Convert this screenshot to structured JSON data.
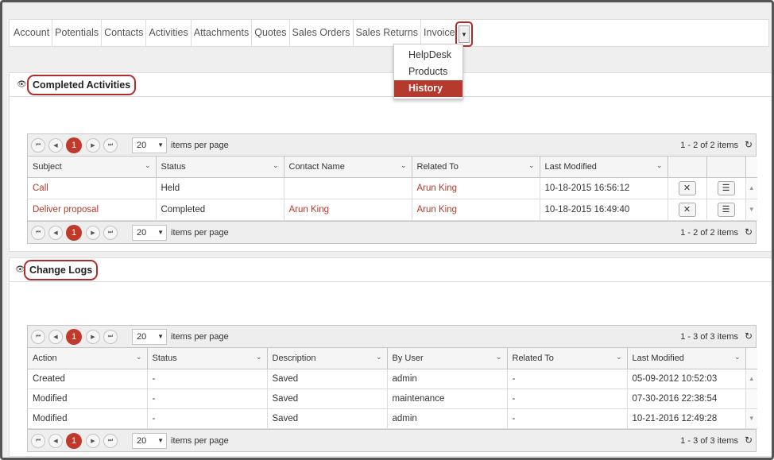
{
  "tabs": [
    "Account",
    "Potentials",
    "Contacts",
    "Activities",
    "Attachments",
    "Quotes",
    "Sales Orders",
    "Sales Returns",
    "Invoices"
  ],
  "more_menu": [
    "HelpDesk",
    "Products",
    "History"
  ],
  "completed": {
    "title": "Completed Activities",
    "page": "1",
    "page_size": "20",
    "items_per_page_label": "items per page",
    "info": "1 - 2 of 2 items",
    "columns": [
      "Subject",
      "Status",
      "Contact Name",
      "Related To",
      "Last Modified"
    ],
    "rows": [
      {
        "subject": "Call",
        "status": "Held",
        "contact": "",
        "related": "Arun King",
        "modified": "10-18-2015 16:56:12"
      },
      {
        "subject": "Deliver proposal",
        "status": "Completed",
        "contact": "Arun King",
        "related": "Arun King",
        "modified": "10-18-2015 16:49:40"
      }
    ]
  },
  "logs": {
    "title": "Change Logs",
    "page": "1",
    "page_size": "20",
    "items_per_page_label": "items per page",
    "info": "1 - 3 of 3 items",
    "columns": [
      "Action",
      "Status",
      "Description",
      "By User",
      "Related To",
      "Last Modified"
    ],
    "rows": [
      {
        "action": "Created",
        "status": "-",
        "description": "Saved",
        "user": "admin",
        "related": "-",
        "modified": "05-09-2012 10:52:03"
      },
      {
        "action": "Modified",
        "status": "-",
        "description": "Saved",
        "user": "maintenance",
        "related": "-",
        "modified": "07-30-2016 22:38:54"
      },
      {
        "action": "Modified",
        "status": "-",
        "description": "Saved",
        "user": "admin",
        "related": "-",
        "modified": "10-21-2016 12:49:28"
      }
    ]
  },
  "icons": {
    "first": "first-page-icon",
    "prev": "prev-page-icon",
    "next": "next-page-icon",
    "last": "last-page-icon",
    "refresh": "refresh-icon",
    "delete": "close-icon",
    "menu": "menu-icon",
    "eye": "eye-icon",
    "chevron": "chevron-down-icon"
  },
  "colors": {
    "accent": "#b5392c",
    "border": "#c5c5c5"
  }
}
